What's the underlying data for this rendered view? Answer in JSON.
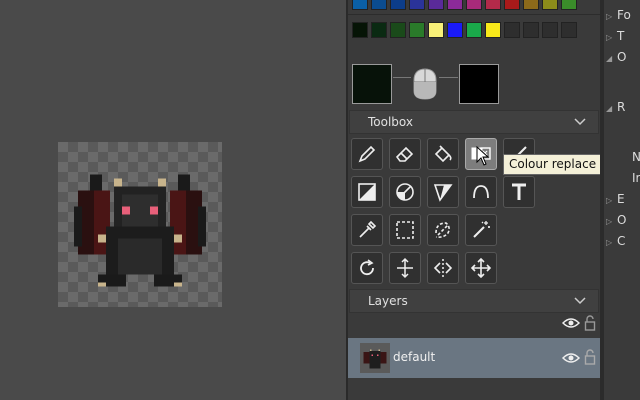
{
  "palette": {
    "row1": [
      "#0a5fa5",
      "#0b4c8f",
      "#0c3d8a",
      "#2a3399",
      "#5a2a99",
      "#8c2a99",
      "#a82a7a",
      "#b32a4a",
      "#a81a1a",
      "#8c6a1a",
      "#8c8c1a",
      "#3a8c2a"
    ],
    "row2": [
      "#061406",
      "#0a2a12",
      "#1a4a1a",
      "#2a7a2a",
      "#f8f078",
      "#1a1af8",
      "#1aa84a",
      "#f8e81a",
      "#2e2e2e",
      "#2e2e2e",
      "#2e2e2e",
      "#2e2e2e"
    ]
  },
  "colors": {
    "primary": "#071209",
    "secondary": "#000000"
  },
  "toolbox": {
    "title": "Toolbox",
    "rows": [
      [
        "pencil-icon",
        "eraser-icon",
        "fill-bucket-icon",
        "colour-replace-icon",
        "line-icon"
      ],
      [
        "shade-icon",
        "dither-icon",
        "gradient-icon",
        "curve-icon",
        "text-icon"
      ],
      [
        "color-picker-icon",
        "rect-select-icon",
        "lasso-icon",
        "magic-wand-icon"
      ],
      [
        "rotate-icon",
        "scale-icon",
        "flip-icon",
        "move-icon"
      ]
    ],
    "active_tool": "colour-replace-icon",
    "tooltip": "Colour replace tool(U)"
  },
  "layers": {
    "title": "Layers",
    "items": [
      {
        "name": "default"
      }
    ]
  },
  "right_panel": {
    "items": [
      "Fo",
      "T",
      "O",
      "R",
      "N",
      "Ir",
      "E",
      "O",
      "C"
    ]
  }
}
